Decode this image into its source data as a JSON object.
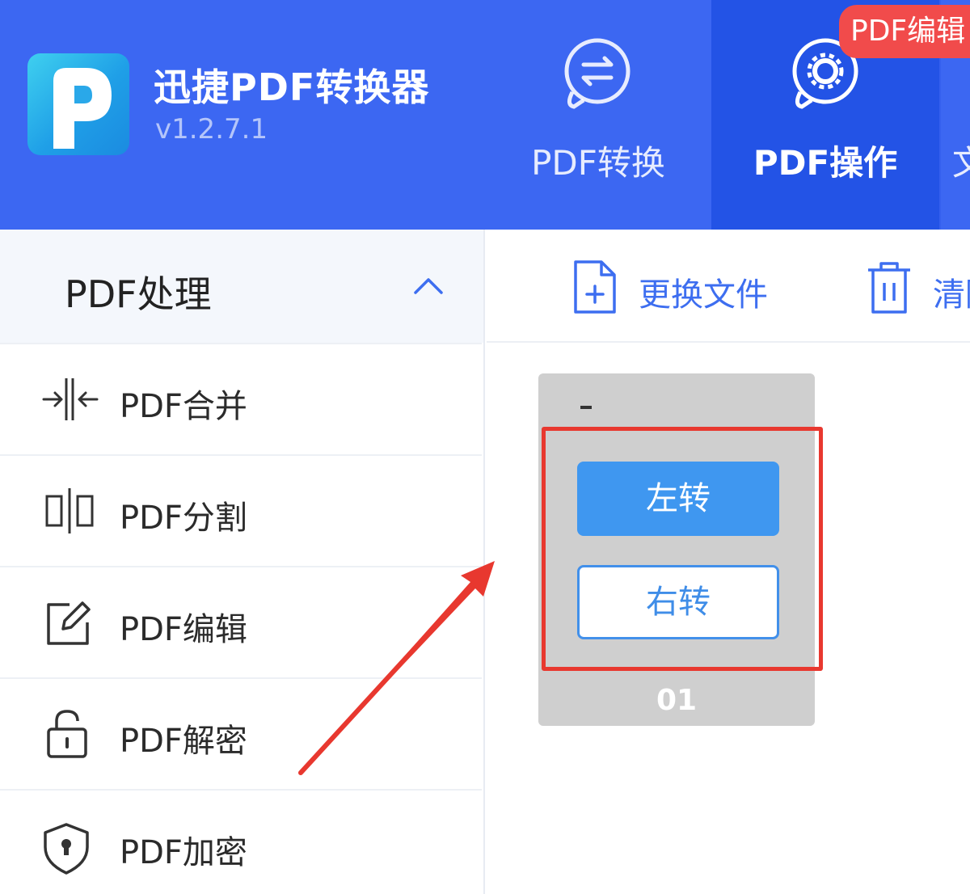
{
  "app": {
    "title": "迅捷PDF转换器",
    "version": "v1.2.7.1"
  },
  "nav": {
    "tabs": [
      {
        "label": "PDF转换",
        "icon": "convert-icon",
        "active": false
      },
      {
        "label": "PDF操作",
        "icon": "gear-icon",
        "active": true
      },
      {
        "label": "文",
        "icon": "",
        "active": false
      }
    ],
    "badge": "PDF编辑"
  },
  "sidebar": {
    "section_title": "PDF处理",
    "items": [
      {
        "label": "PDF合并",
        "icon": "merge-icon"
      },
      {
        "label": "PDF分割",
        "icon": "split-icon"
      },
      {
        "label": "PDF编辑",
        "icon": "edit-icon"
      },
      {
        "label": "PDF解密",
        "icon": "unlock-icon"
      },
      {
        "label": "PDF加密",
        "icon": "shield-lock-icon"
      }
    ]
  },
  "toolbar": {
    "replace_label": "更换文件",
    "clear_label": "清除"
  },
  "page_card": {
    "rotate_left": "左转",
    "rotate_right": "右转",
    "page_number": "01"
  },
  "colors": {
    "header": "#3C67F2",
    "active_tab": "#2353E6",
    "badge": "#F14B4B",
    "accent": "#3F97F0",
    "annotation": "#E8382F"
  }
}
